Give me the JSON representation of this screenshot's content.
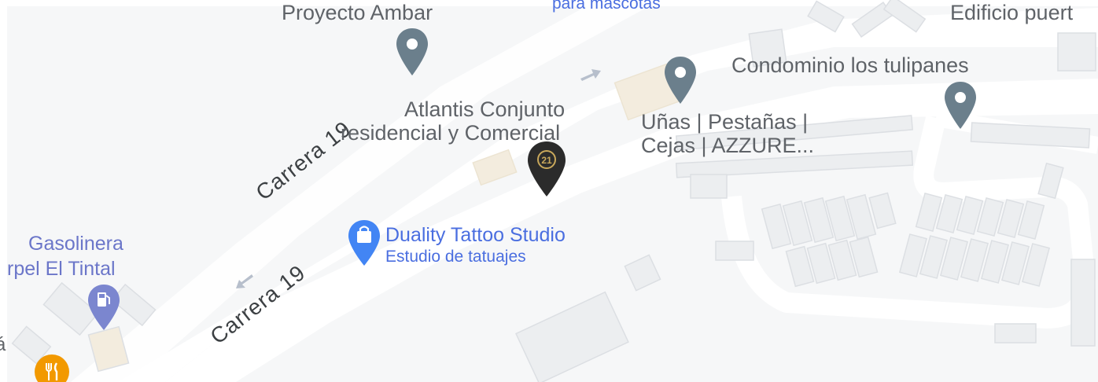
{
  "labels": {
    "proyecto_ambar": "Proyecto Ambar",
    "para_mascotas": "para mascotas",
    "edificio": "Edificio puert",
    "condominio": "Condominio los tulipanes",
    "atlantis_line1": "Atlantis Conjunto",
    "atlantis_line2": "residencial y Comercial",
    "unas_line1": "Uñas | Pestañas |",
    "unas_line2": "Cejas | AZZURE...",
    "duality_name": "Duality Tattoo Studio",
    "duality_category": "Estudio de tatuajes",
    "gasolinera_line1": "Gasolinera",
    "gasolinera_line2": "rpel El Tintal",
    "street_upper": "Carrera 19",
    "street_lower": "Carrera 19",
    "edge_letter": "á"
  },
  "pins": {
    "generic_color": "#6b7f8c",
    "century21_color": "#2b2b2b",
    "century21_badge": "21",
    "shopping_color": "#4285f4",
    "gas_color": "#7b86cf",
    "restaurant_color": "#f29900"
  },
  "icons": {
    "proyecto_ambar": "location-pin-icon",
    "unas": "location-pin-icon",
    "condominio": "location-pin-icon",
    "atlantis": "century21-pin-icon",
    "duality": "shopping-bag-pin-icon",
    "gasolinera": "gas-station-pin-icon",
    "restaurant": "restaurant-icon"
  },
  "colors": {
    "land": "#f6f7f8",
    "road": "#ffffff",
    "building_fill": "#eceef0",
    "building_stroke": "#dcdfe3",
    "arrow": "#b7bfcc"
  }
}
